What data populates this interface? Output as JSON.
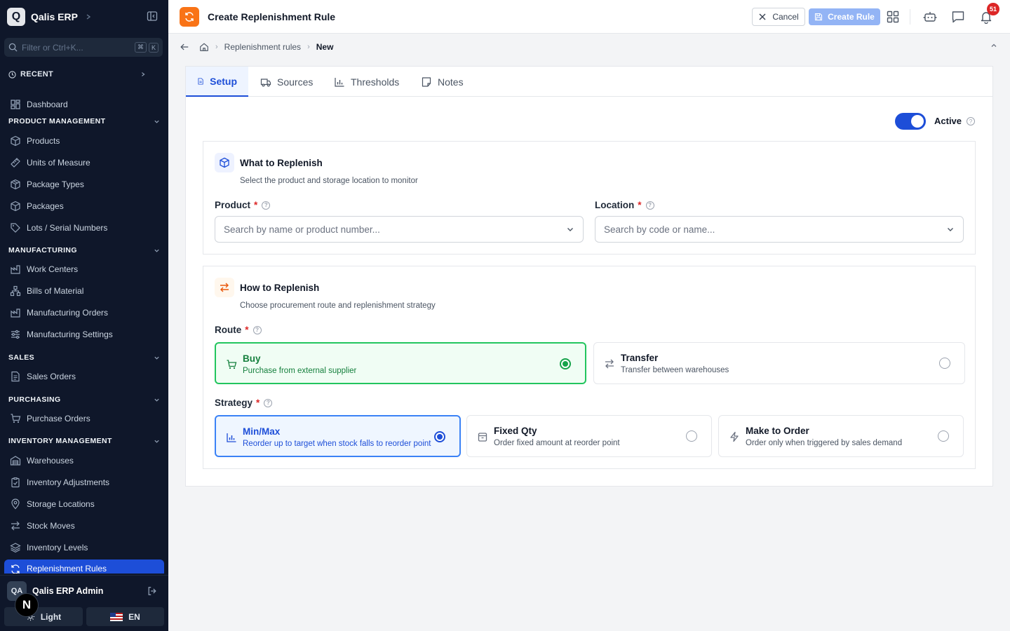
{
  "app": {
    "logo_letter": "Q",
    "name": "Qalis ERP"
  },
  "sidebar": {
    "filter_placeholder": "Filter or Ctrl+K...",
    "filter_shortcut": [
      "⌘",
      "K"
    ],
    "recent_label": "RECENT",
    "dashboard_label": "Dashboard",
    "sections": {
      "product_management": {
        "label": "PRODUCT MANAGEMENT",
        "items": [
          "Products",
          "Units of Measure",
          "Package Types",
          "Packages",
          "Lots / Serial Numbers"
        ]
      },
      "manufacturing": {
        "label": "MANUFACTURING",
        "items": [
          "Work Centers",
          "Bills of Material",
          "Manufacturing Orders",
          "Manufacturing Settings"
        ]
      },
      "sales": {
        "label": "SALES",
        "items": [
          "Sales Orders"
        ]
      },
      "purchasing": {
        "label": "PURCHASING",
        "items": [
          "Purchase Orders"
        ]
      },
      "inventory_management": {
        "label": "INVENTORY MANAGEMENT",
        "items": [
          "Warehouses",
          "Inventory Adjustments",
          "Storage Locations",
          "Stock Moves",
          "Inventory Levels",
          "Replenishment Rules"
        ]
      }
    },
    "user": {
      "initials": "QA",
      "name": "Qalis ERP Admin"
    },
    "theme_label": "Light",
    "language_label": "EN",
    "next_badge": "N"
  },
  "header": {
    "title": "Create Replenishment Rule",
    "cancel_label": "Cancel",
    "create_label": "Create Rule",
    "notification_count": "51"
  },
  "breadcrumb": {
    "items": [
      "Replenishment rules",
      "New"
    ]
  },
  "tabs": [
    "Setup",
    "Sources",
    "Thresholds",
    "Notes"
  ],
  "form": {
    "active_label": "Active",
    "active": true,
    "what_section": {
      "title": "What to Replenish",
      "subtitle": "Select the product and storage location to monitor",
      "product_label": "Product",
      "product_placeholder": "Search by name or product number...",
      "location_label": "Location",
      "location_placeholder": "Search by code or name..."
    },
    "how_section": {
      "title": "How to Replenish",
      "subtitle": "Choose procurement route and replenishment strategy",
      "route_label": "Route",
      "routes": [
        {
          "title": "Buy",
          "description": "Purchase from external supplier",
          "selected": true
        },
        {
          "title": "Transfer",
          "description": "Transfer between warehouses",
          "selected": false
        }
      ],
      "strategy_label": "Strategy",
      "strategies": [
        {
          "title": "Min/Max",
          "description": "Reorder up to target when stock falls to reorder point",
          "selected": true
        },
        {
          "title": "Fixed Qty",
          "description": "Order fixed amount at reorder point",
          "selected": false
        },
        {
          "title": "Make to Order",
          "description": "Order only when triggered by sales demand",
          "selected": false
        }
      ]
    }
  },
  "colors": {
    "primary": "#1d4ed8",
    "sidebar_bg": "#0f172a",
    "accent_orange": "#f97316",
    "success": "#16a34a",
    "danger": "#dc2626"
  }
}
